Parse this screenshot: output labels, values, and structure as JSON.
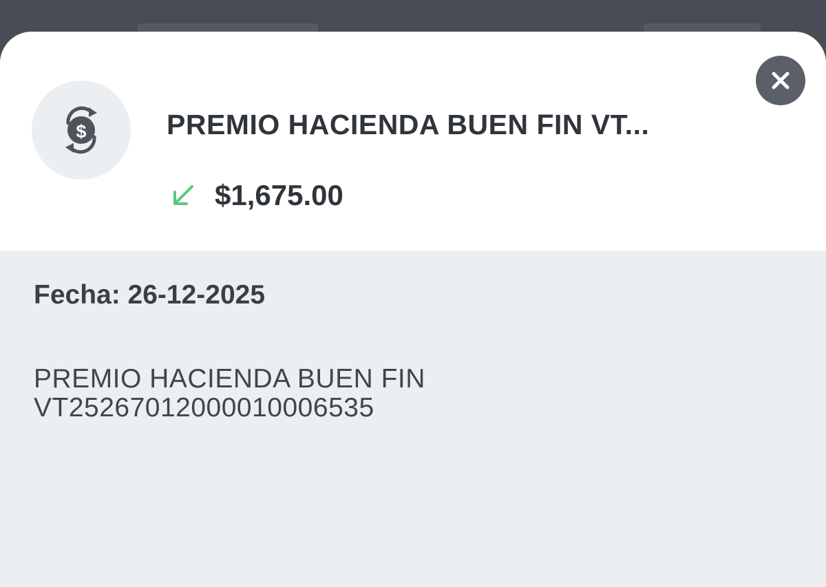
{
  "transaction": {
    "title": "PREMIO HACIENDA BUEN FIN VT...",
    "amount": "$1,675.00",
    "direction_icon": "arrow-down-left-icon",
    "direction_color": "#5cc87a",
    "category_icon": "money-exchange-icon"
  },
  "details": {
    "date_label": "Fecha:",
    "date_value": "26-12-2025",
    "description_line1": "PREMIO HACIENDA BUEN FIN",
    "description_line2": "VT25267012000010006535"
  },
  "colors": {
    "header_background": "#ffffff",
    "detail_background": "#eceff2",
    "close_button": "#5b6068",
    "text_primary": "#30343b",
    "backdrop": "#484c54"
  },
  "icons": {
    "close": "close-icon"
  }
}
